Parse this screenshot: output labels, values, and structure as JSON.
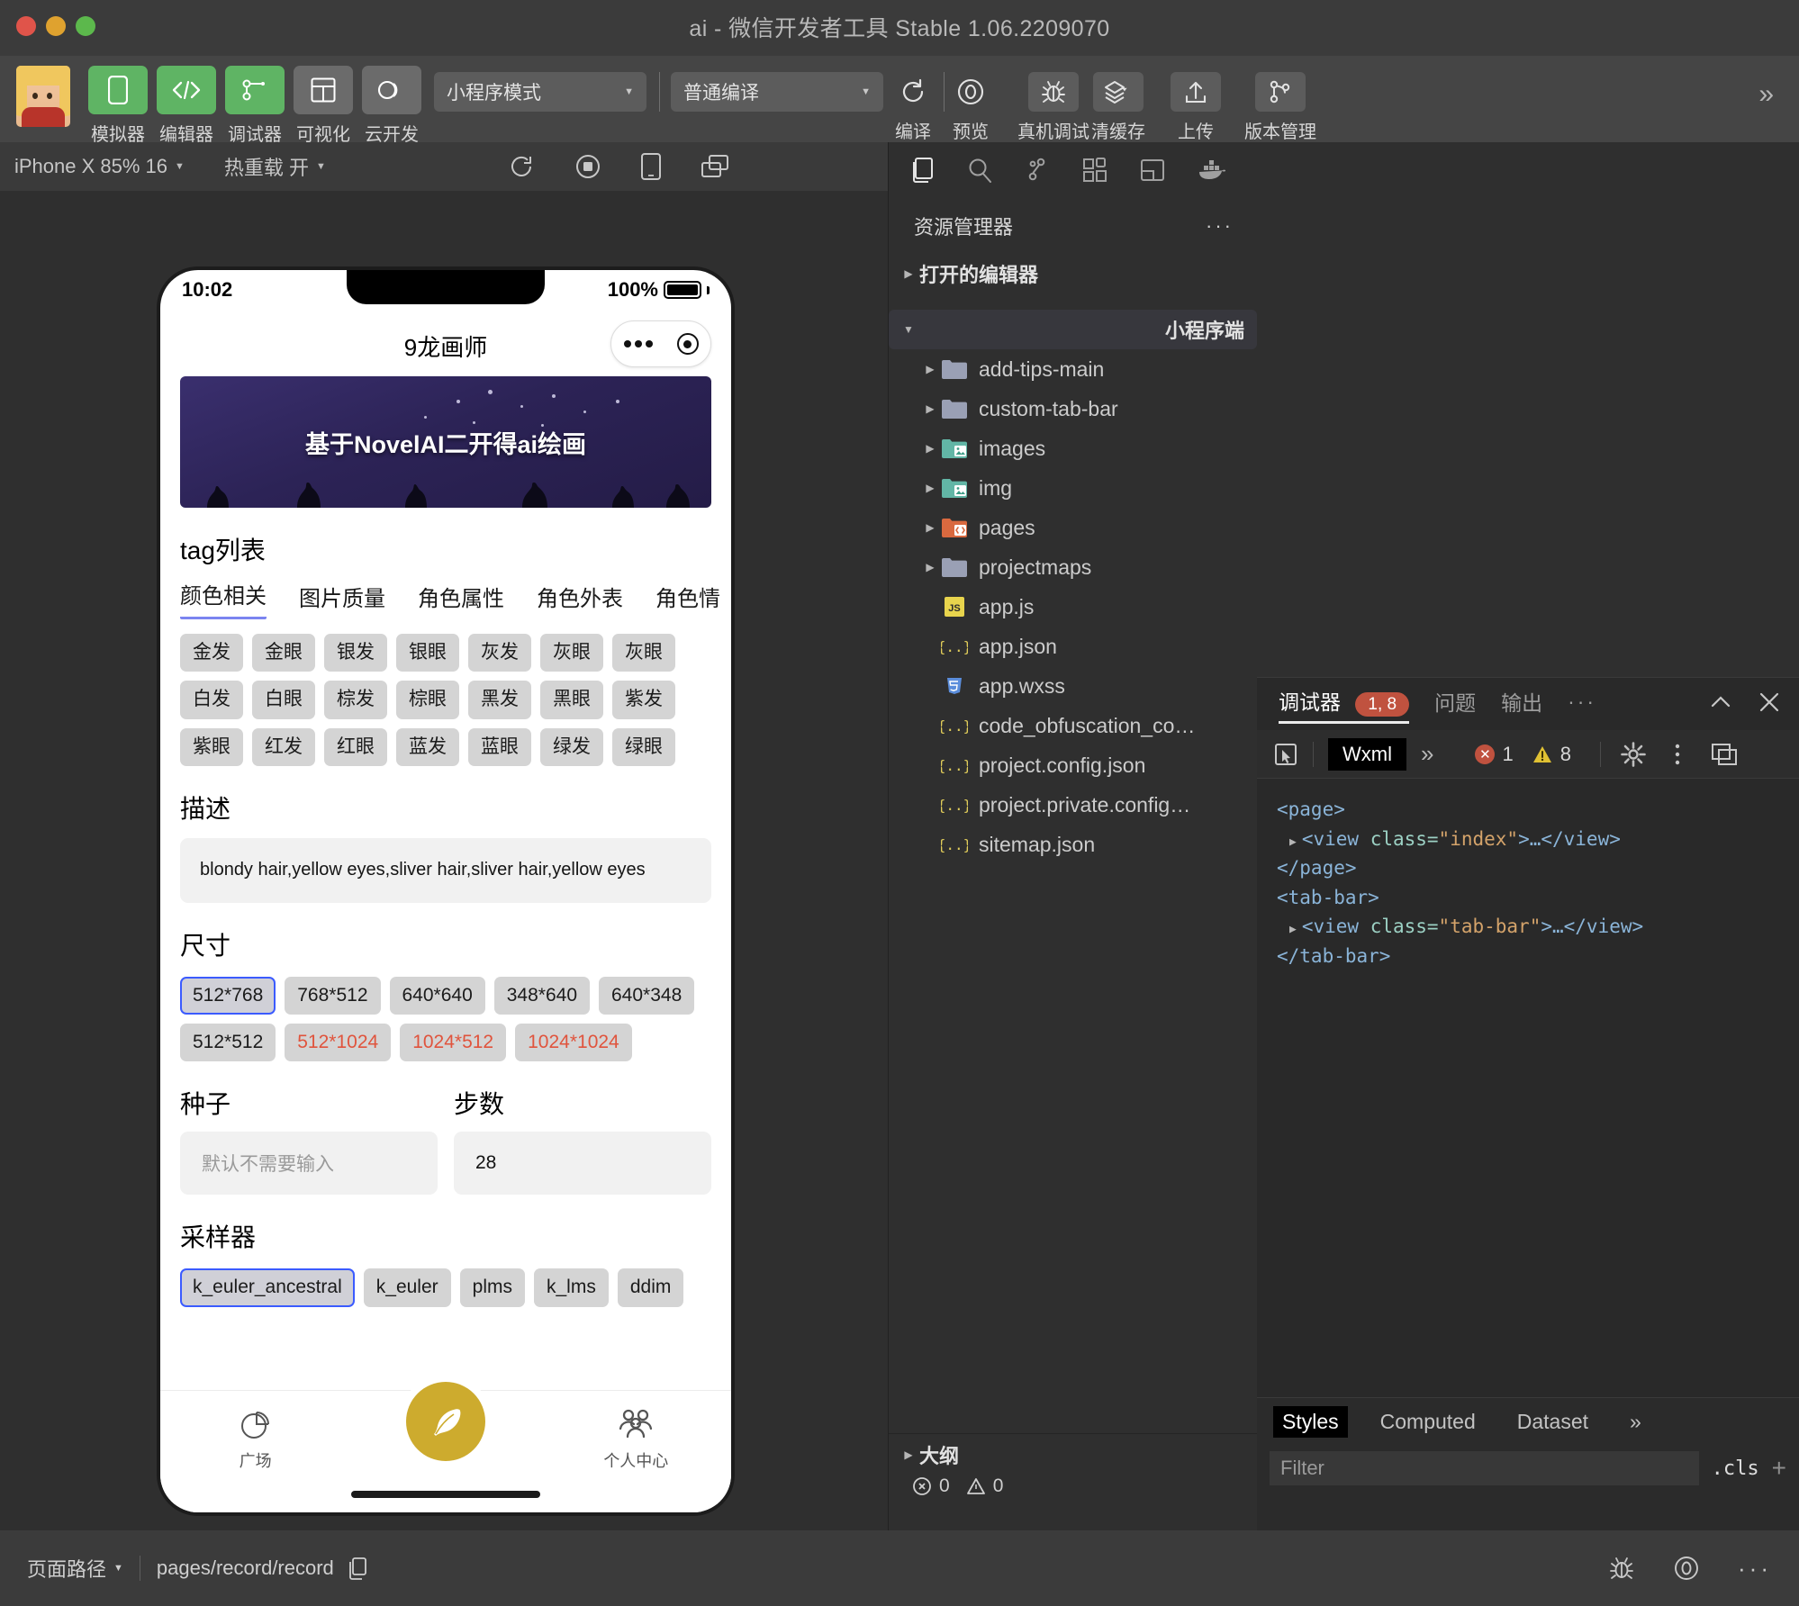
{
  "window": {
    "title": "ai - 微信开发者工具 Stable 1.06.2209070"
  },
  "toolbar": {
    "items": [
      {
        "label": "模拟器",
        "icon": "phone-icon",
        "style": "green"
      },
      {
        "label": "编辑器",
        "icon": "code-icon",
        "style": "green"
      },
      {
        "label": "调试器",
        "icon": "debug-nodes-icon",
        "style": "green"
      },
      {
        "label": "可视化",
        "icon": "layout-icon",
        "style": "gray"
      },
      {
        "label": "云开发",
        "icon": "cloud-icon",
        "style": "gray"
      }
    ],
    "mode_select": "小程序模式",
    "compile_select": "普通编译",
    "actions": [
      {
        "label": "编译",
        "icon": "refresh-icon"
      },
      {
        "label": "预览",
        "icon": "eye-icon"
      },
      {
        "label": "真机调试",
        "icon": "bug-icon"
      },
      {
        "label": "清缓存",
        "icon": "layers-icon"
      },
      {
        "label": "上传",
        "icon": "upload-icon"
      },
      {
        "label": "版本管理",
        "icon": "branch-icon"
      }
    ],
    "overflow": "»"
  },
  "simulator": {
    "device": "iPhone X 85% 16",
    "hot_reload": "热重载 开",
    "icons": [
      "refresh-icon",
      "record-stop-icon",
      "device-icon",
      "multi-window-icon"
    ]
  },
  "phone": {
    "status_time": "10:02",
    "battery_percent": "100%",
    "nav_title": "9龙画师",
    "banner_text": "基于NovelAI二开得ai绘画",
    "tag_section_title": "tag列表",
    "tabs": [
      {
        "label": "颜色相关",
        "active": true
      },
      {
        "label": "图片质量",
        "active": false
      },
      {
        "label": "角色属性",
        "active": false
      },
      {
        "label": "角色外表",
        "active": false
      },
      {
        "label": "角色情",
        "active": false
      }
    ],
    "tags": [
      "金发",
      "金眼",
      "银发",
      "银眼",
      "灰发",
      "灰眼",
      "灰眼",
      "白发",
      "白眼",
      "棕发",
      "棕眼",
      "黑发",
      "黑眼",
      "紫发",
      "紫眼",
      "红发",
      "红眼",
      "蓝发",
      "蓝眼",
      "绿发",
      "绿眼"
    ],
    "desc_title": "描述",
    "desc_value": "blondy hair,yellow eyes,sliver hair,sliver hair,yellow eyes",
    "size_title": "尺寸",
    "sizes": [
      {
        "label": "512*768",
        "state": "selected"
      },
      {
        "label": "768*512",
        "state": "normal"
      },
      {
        "label": "640*640",
        "state": "normal"
      },
      {
        "label": "348*640",
        "state": "normal"
      },
      {
        "label": "640*348",
        "state": "normal"
      },
      {
        "label": "512*512",
        "state": "normal"
      },
      {
        "label": "512*1024",
        "state": "warn"
      },
      {
        "label": "1024*512",
        "state": "warn"
      },
      {
        "label": "1024*1024",
        "state": "warn"
      }
    ],
    "seed_title": "种子",
    "seed_placeholder": "默认不需要输入",
    "steps_title": "步数",
    "steps_value": "28",
    "sampler_title": "采样器",
    "samplers": [
      {
        "label": "k_euler_ancestral",
        "state": "selected"
      },
      {
        "label": "k_euler",
        "state": "normal"
      },
      {
        "label": "plms",
        "state": "normal"
      },
      {
        "label": "k_lms",
        "state": "normal"
      },
      {
        "label": "ddim",
        "state": "normal"
      }
    ],
    "tabbar": [
      {
        "label": "广场",
        "icon": "pie-chart-icon"
      },
      {
        "label": "",
        "icon": "feather-icon"
      },
      {
        "label": "个人中心",
        "icon": "people-icon"
      }
    ]
  },
  "explorer": {
    "activity_icons": [
      "files-icon",
      "search-icon",
      "source-control-icon",
      "extensions-icon",
      "split-editor-icon",
      "docker-icon"
    ],
    "header": "资源管理器",
    "header_more": "···",
    "groups": [
      {
        "label": "打开的编辑器",
        "expanded": false
      },
      {
        "label": "小程序端",
        "expanded": true
      }
    ],
    "files": [
      {
        "name": "add-tips-main",
        "type": "folder",
        "color": "#9aa0b5",
        "expandable": true
      },
      {
        "name": "custom-tab-bar",
        "type": "folder",
        "color": "#9aa0b5",
        "expandable": true
      },
      {
        "name": "images",
        "type": "folder-img",
        "color": "#62b6a6",
        "expandable": true
      },
      {
        "name": "img",
        "type": "folder-img",
        "color": "#62b6a6",
        "expandable": true
      },
      {
        "name": "pages",
        "type": "folder-code",
        "color": "#d9693f",
        "expandable": true
      },
      {
        "name": "projectmaps",
        "type": "folder",
        "color": "#9aa0b5",
        "expandable": true
      },
      {
        "name": "app.js",
        "type": "js",
        "color": "#e8d44d",
        "expandable": false
      },
      {
        "name": "app.json",
        "type": "json",
        "color": "#e0cc5a",
        "expandable": false
      },
      {
        "name": "app.wxss",
        "type": "css",
        "color": "#5b8ddb",
        "expandable": false
      },
      {
        "name": "code_obfuscation_co…",
        "type": "json",
        "color": "#e0cc5a",
        "expandable": false
      },
      {
        "name": "project.config.json",
        "type": "json",
        "color": "#e0cc5a",
        "expandable": false
      },
      {
        "name": "project.private.config…",
        "type": "json",
        "color": "#e0cc5a",
        "expandable": false
      },
      {
        "name": "sitemap.json",
        "type": "json",
        "color": "#e0cc5a",
        "expandable": false
      }
    ],
    "outline_label": "大纲",
    "problem_errors": "0",
    "problem_warnings": "0"
  },
  "debugger": {
    "tabs": [
      {
        "label": "调试器",
        "active": true,
        "badge": "1, 8"
      },
      {
        "label": "问题",
        "active": false,
        "badge": ""
      },
      {
        "label": "输出",
        "active": false,
        "badge": ""
      }
    ],
    "tab_more": "···",
    "collapse_icon": "chevron-up-icon",
    "close_icon": "close-icon",
    "sub_tabs": [
      {
        "label": "Wxml",
        "active": true
      }
    ],
    "sub_more": "»",
    "error_count": "1",
    "warning_count": "8",
    "code_lines": [
      {
        "indent": 0,
        "arrow": false,
        "parts": [
          {
            "t": "<page>",
            "c": "tag"
          }
        ]
      },
      {
        "indent": 1,
        "arrow": true,
        "parts": [
          {
            "t": "<view ",
            "c": "tag"
          },
          {
            "t": "class=",
            "c": "attr"
          },
          {
            "t": "\"index\"",
            "c": "val"
          },
          {
            "t": ">…</view>",
            "c": "tag"
          }
        ]
      },
      {
        "indent": 0,
        "arrow": false,
        "parts": [
          {
            "t": "</page>",
            "c": "tag"
          }
        ]
      },
      {
        "indent": 0,
        "arrow": false,
        "parts": [
          {
            "t": "<tab-bar>",
            "c": "tag"
          }
        ]
      },
      {
        "indent": 1,
        "arrow": true,
        "parts": [
          {
            "t": "<view ",
            "c": "tag"
          },
          {
            "t": "class=",
            "c": "attr"
          },
          {
            "t": "\"tab-bar\"",
            "c": "val"
          },
          {
            "t": ">…</view>",
            "c": "tag"
          }
        ]
      },
      {
        "indent": 0,
        "arrow": false,
        "parts": [
          {
            "t": "</tab-bar>",
            "c": "tag"
          }
        ]
      }
    ],
    "style_tabs": [
      {
        "label": "Styles",
        "active": true
      },
      {
        "label": "Computed",
        "active": false
      },
      {
        "label": "Dataset",
        "active": false
      }
    ],
    "style_more": "»",
    "filter_placeholder": "Filter",
    "cls_label": ".cls",
    "plus_label": "+"
  },
  "statusbar": {
    "page_path_label": "页面路径",
    "page_path_value": "pages/record/record",
    "copy_icon": "copy-icon",
    "right_icons": [
      "bug-icon",
      "eye-icon",
      "more-icon"
    ]
  },
  "colors": {
    "accent_green": "#5fb464",
    "selected_blue": "#3b5bff",
    "warn_red": "#e0543d",
    "badge_red": "#c0523f",
    "fab_gold": "#cdab2e"
  }
}
